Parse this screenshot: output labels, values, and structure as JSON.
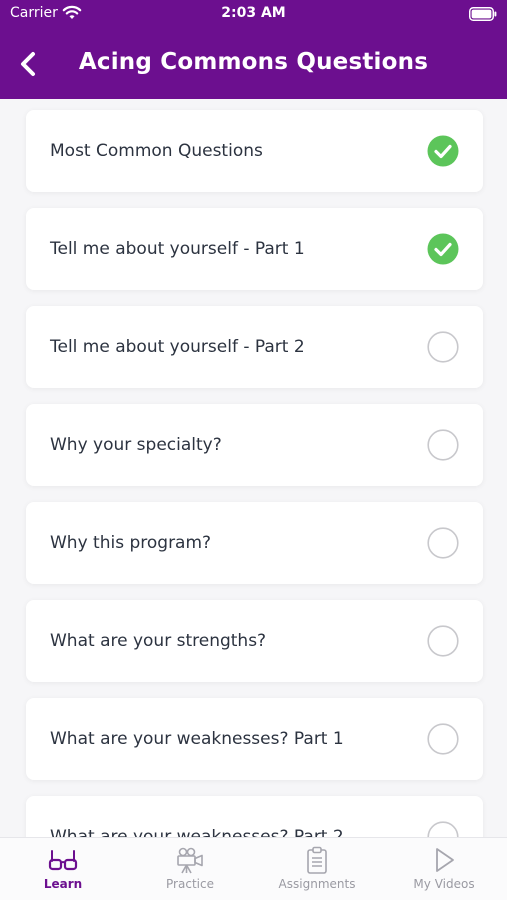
{
  "status_bar": {
    "carrier": "Carrier",
    "time": "2:03 AM"
  },
  "nav": {
    "title": "Acing Commons Questions",
    "back_icon": "chevron-left-icon"
  },
  "colors": {
    "brand": "#6c0f8f",
    "complete": "#5cc55a",
    "incomplete_ring": "#c8c8cc"
  },
  "lessons": [
    {
      "label": "Most Common Questions",
      "completed": true
    },
    {
      "label": "Tell me about yourself - Part 1",
      "completed": true
    },
    {
      "label": "Tell me about yourself - Part 2",
      "completed": false
    },
    {
      "label": "Why your specialty?",
      "completed": false
    },
    {
      "label": "Why this program?",
      "completed": false
    },
    {
      "label": "What are your strengths?",
      "completed": false
    },
    {
      "label": "What are your weaknesses? Part 1",
      "completed": false
    },
    {
      "label": "What are your weaknesses? Part 2",
      "completed": false
    }
  ],
  "tabs": [
    {
      "label": "Learn",
      "icon": "glasses-icon",
      "active": true
    },
    {
      "label": "Practice",
      "icon": "video-camera-icon",
      "active": false
    },
    {
      "label": "Assignments",
      "icon": "clipboard-icon",
      "active": false
    },
    {
      "label": "My Videos",
      "icon": "play-icon",
      "active": false
    }
  ]
}
